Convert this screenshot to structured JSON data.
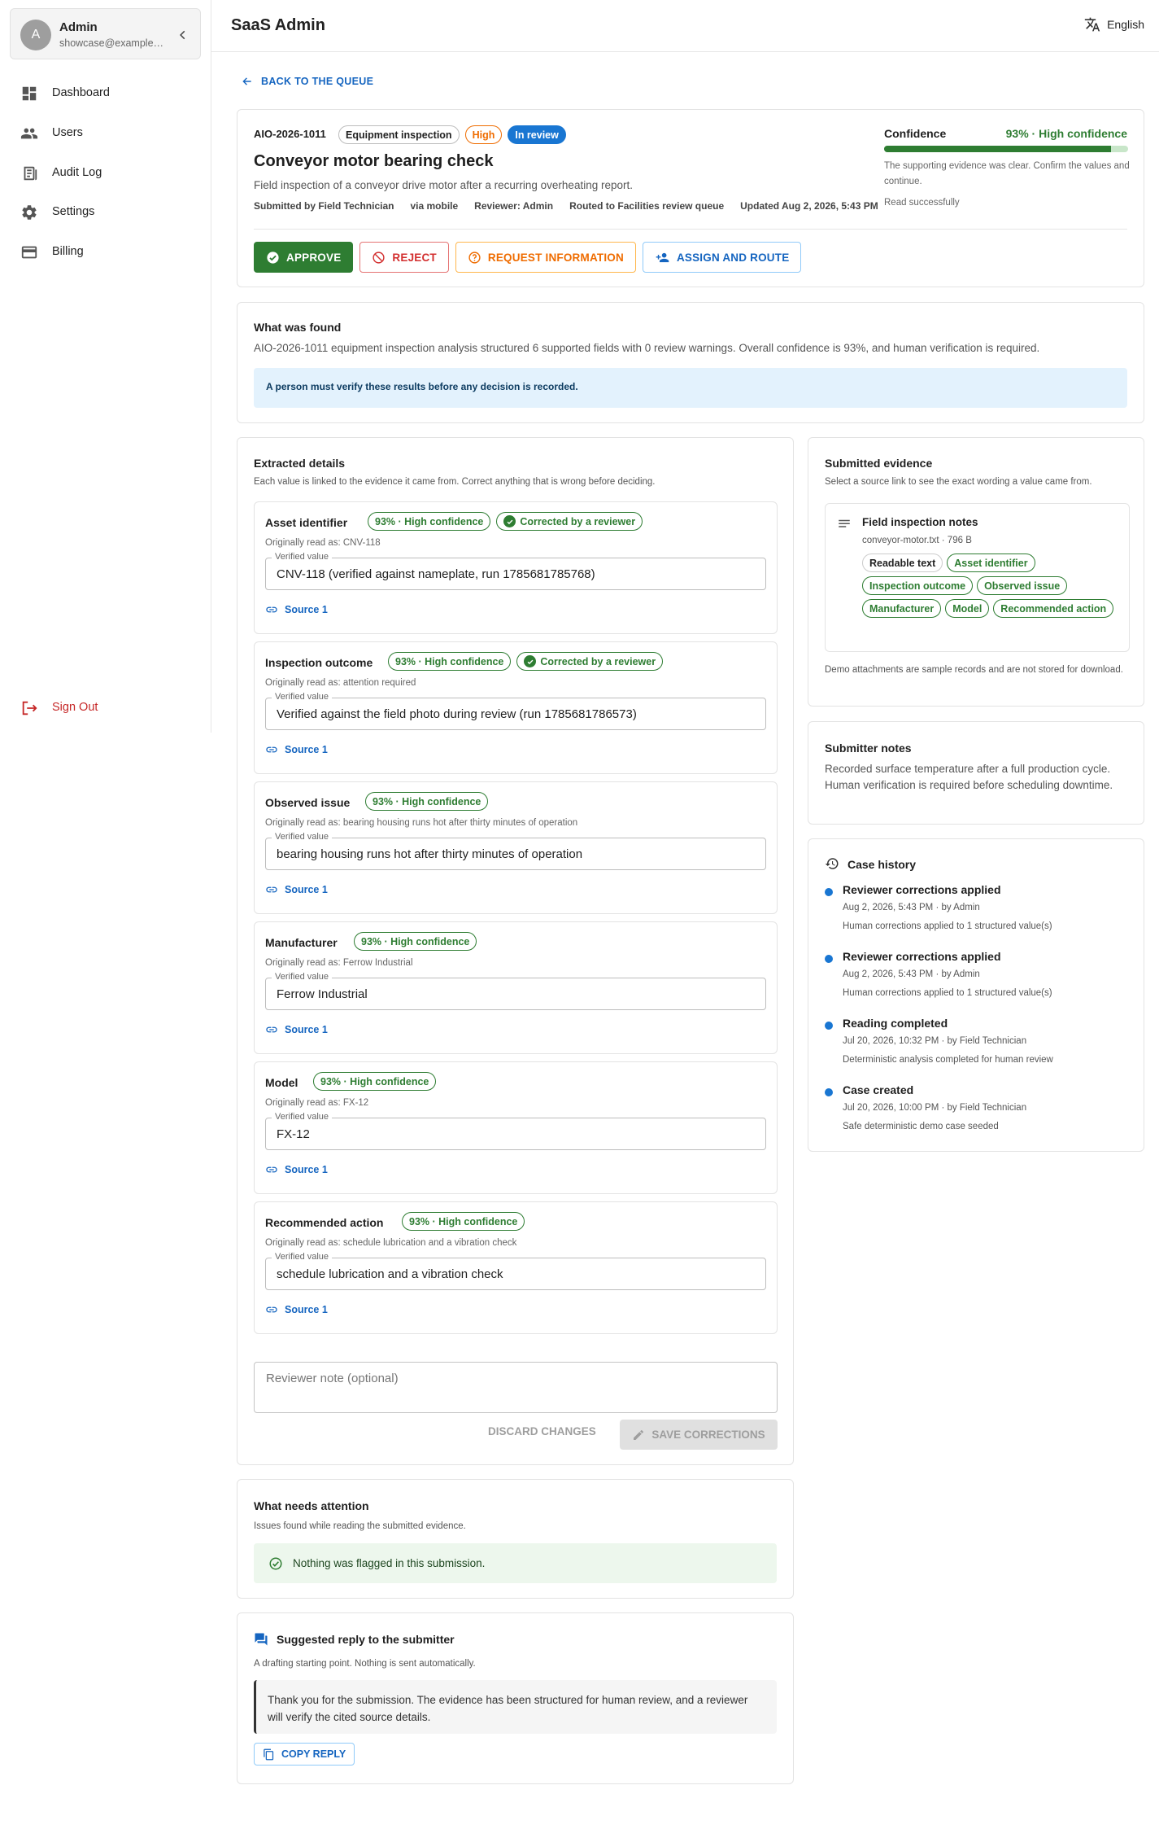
{
  "sidebar": {
    "account": {
      "initial": "A",
      "name": "Admin",
      "email": "showcase@example.com"
    },
    "nav": [
      {
        "label": "Dashboard",
        "icon": "dashboard-icon"
      },
      {
        "label": "Users",
        "icon": "users-icon"
      },
      {
        "label": "Audit Log",
        "icon": "audit-log-icon"
      },
      {
        "label": "Settings",
        "icon": "gear-icon"
      },
      {
        "label": "Billing",
        "icon": "credit-card-icon"
      }
    ],
    "sign_out": "Sign Out"
  },
  "header": {
    "title": "SaaS Admin",
    "language": "English"
  },
  "back_label": "BACK TO THE QUEUE",
  "case": {
    "id": "AIO-2026-1011",
    "type": "Equipment inspection",
    "priority": "High",
    "status": "In review",
    "title": "Conveyor motor bearing check",
    "description": "Field inspection of a conveyor drive motor after a recurring overheating report.",
    "meta": {
      "submitted": "Submitted by Field Technician",
      "channel": "via mobile",
      "reviewer": "Reviewer: Admin",
      "route": "Routed to Facilities review queue",
      "updated": "Updated Aug 2, 2026, 5:43 PM"
    },
    "confidence": {
      "label": "Confidence",
      "value": "93% · High confidence",
      "fraction": 0.93,
      "note": "The supporting evidence was clear. Confirm the values and continue.",
      "status": "Read successfully"
    },
    "actions": {
      "approve": "APPROVE",
      "reject": "REJECT",
      "request": "REQUEST INFORMATION",
      "assign": "ASSIGN AND ROUTE"
    }
  },
  "found": {
    "title": "What was found",
    "body": "AIO-2026-1011 equipment inspection analysis structured 6 supported fields with 0 review warnings. Overall confidence is 93%, and human verification is required.",
    "alert": "A person must verify these results before any decision is recorded."
  },
  "extracted": {
    "title": "Extracted details",
    "subtitle": "Each value is linked to the evidence it came from. Correct anything that is wrong before deciding.",
    "confidence_chip": "93% · High confidence",
    "corrected_chip": "Corrected by a reviewer",
    "verified_label": "Verified value",
    "source_label": "Source 1",
    "fields": [
      {
        "name": "Asset identifier",
        "orig": "Originally read as: CNV-118",
        "value": "CNV-118 (verified against nameplate, run 1785681785768)",
        "corrected": true
      },
      {
        "name": "Inspection outcome",
        "orig": "Originally read as: attention required",
        "value": "Verified against the field photo during review (run 1785681786573)",
        "corrected": true
      },
      {
        "name": "Observed issue",
        "orig": "Originally read as: bearing housing runs hot after thirty minutes of operation",
        "value": "bearing housing runs hot after thirty minutes of operation",
        "corrected": false
      },
      {
        "name": "Manufacturer",
        "orig": "Originally read as: Ferrow Industrial",
        "value": "Ferrow Industrial",
        "corrected": false
      },
      {
        "name": "Model",
        "orig": "Originally read as: FX-12",
        "value": "FX-12",
        "corrected": false
      },
      {
        "name": "Recommended action",
        "orig": "Originally read as: schedule lubrication and a vibration check",
        "value": "schedule lubrication and a vibration check",
        "corrected": false
      }
    ],
    "note_placeholder": "Reviewer note (optional)",
    "discard": "DISCARD CHANGES",
    "save": "SAVE CORRECTIONS"
  },
  "evidence": {
    "title": "Submitted evidence",
    "subtitle": "Select a source link to see the exact wording a value came from.",
    "file_title": "Field inspection notes",
    "file_meta": "conveyor-motor.txt · 796 B",
    "chips": [
      "Readable text",
      "Asset identifier",
      "Inspection outcome",
      "Observed issue",
      "Manufacturer",
      "Model",
      "Recommended action"
    ],
    "footer": "Demo attachments are sample records and are not stored for download."
  },
  "submitter_notes": {
    "title": "Submitter notes",
    "body": "Recorded surface temperature after a full production cycle. Human verification is required before scheduling downtime."
  },
  "history": {
    "title": "Case history",
    "items": [
      {
        "title": "Reviewer corrections applied",
        "meta": "Aug 2, 2026, 5:43 PM · by Admin",
        "desc": "Human corrections applied to 1 structured value(s)"
      },
      {
        "title": "Reviewer corrections applied",
        "meta": "Aug 2, 2026, 5:43 PM · by Admin",
        "desc": "Human corrections applied to 1 structured value(s)"
      },
      {
        "title": "Reading completed",
        "meta": "Jul 20, 2026, 10:32 PM · by Field Technician",
        "desc": "Deterministic analysis completed for human review"
      },
      {
        "title": "Case created",
        "meta": "Jul 20, 2026, 10:00 PM · by Field Technician",
        "desc": "Safe deterministic demo case seeded"
      }
    ]
  },
  "attention": {
    "title": "What needs attention",
    "subtitle": "Issues found while reading the submitted evidence.",
    "ok": "Nothing was flagged in this submission."
  },
  "reply": {
    "title": "Suggested reply to the submitter",
    "subtitle": "A drafting starting point. Nothing is sent automatically.",
    "body": "Thank you for the submission. The evidence has been structured for human review, and a reviewer will verify the cited source details.",
    "copy": "COPY REPLY"
  }
}
